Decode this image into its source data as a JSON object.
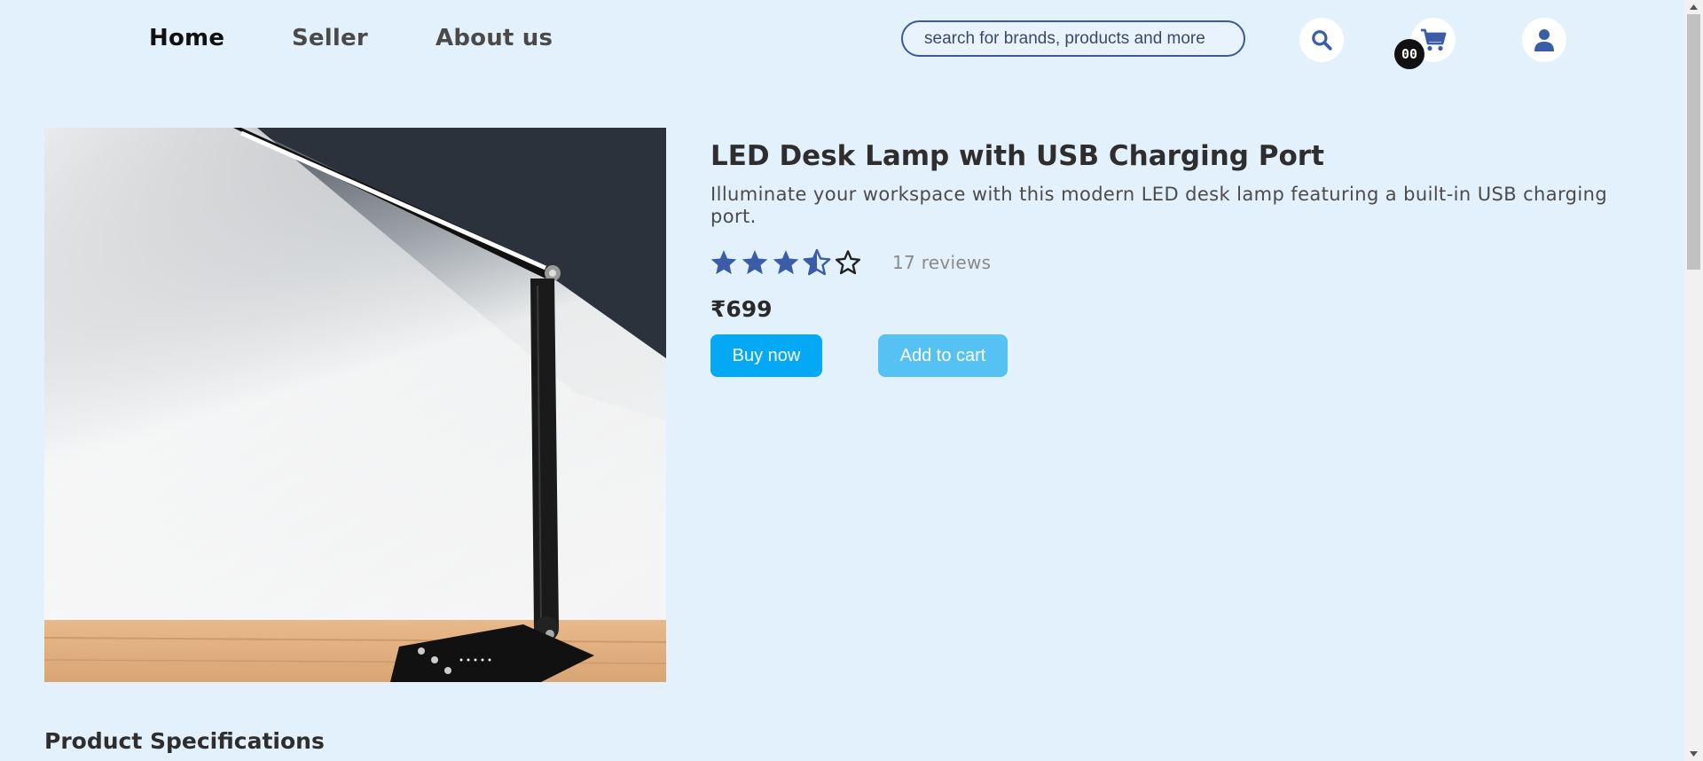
{
  "nav": {
    "home": "Home",
    "seller": "Seller",
    "about": "About us"
  },
  "search": {
    "placeholder": "search for brands, products and more"
  },
  "icons": {
    "search": "search-icon",
    "cart": "cart-icon",
    "user": "user-icon"
  },
  "cart": {
    "count": "00"
  },
  "product": {
    "title": "LED Desk Lamp with USB Charging Port",
    "description": "Illuminate your workspace with this modern LED desk lamp featuring a built-in USB charging port.",
    "rating": 3.5,
    "rating_max": 5,
    "reviews": "17 reviews",
    "price": "₹699"
  },
  "actions": {
    "buy_now": "Buy now",
    "add_to_cart": "Add to cart"
  },
  "sections": {
    "specifications": "Product Specifications"
  },
  "colors": {
    "background": "#e3f1fc",
    "accent": "#3b5da8",
    "buy_button": "#03a9f4",
    "cart_button": "#56c2f3"
  }
}
